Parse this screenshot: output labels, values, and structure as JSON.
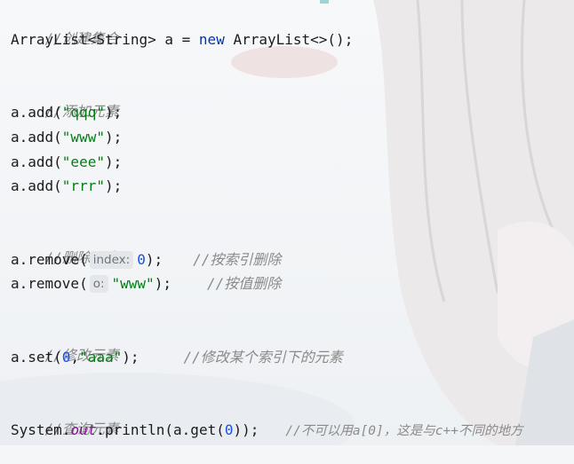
{
  "code": {
    "c_create": "//创建集合",
    "l_create": {
      "a": "ArrayList<String> a = ",
      "kw": "new",
      "b": " ArrayList<>();"
    },
    "c_add": "//添加元素",
    "add1": {
      "a": "a.add(",
      "s": "\"qqq\"",
      "b": ");"
    },
    "add2": {
      "a": "a.add(",
      "s": "\"www\"",
      "b": ");"
    },
    "add3": {
      "a": "a.add(",
      "s": "\"eee\"",
      "b": ");"
    },
    "add4": {
      "a": "a.add(",
      "s": "\"rrr\"",
      "b": ");"
    },
    "c_remove": "//删除元素",
    "rm1": {
      "a": "a.remove(",
      "hint": "index:",
      "n": "0",
      "b": ");",
      "c": "//按索引删除"
    },
    "rm2": {
      "a": "a.remove(",
      "hint": "o:",
      "s": "\"www\"",
      "b": ");",
      "c": "//按值删除"
    },
    "c_set": "//修改元素",
    "set1": {
      "a": "a.set(",
      "n": "0",
      "comma": ",",
      "s": "\"aaa\"",
      "b": ");",
      "c": "//修改某个索引下的元素"
    },
    "c_get": "//查询元素",
    "get1": {
      "a": "System.",
      "f": "out",
      "b": ".println(a.get(",
      "n": "0",
      "d": "));",
      "c": "//不可以用a[0]，这是与c++不同的地方"
    }
  },
  "colors": {
    "keyword": "#0033b3",
    "string": "#067d17",
    "number": "#1750eb",
    "comment": "#8a8a8a",
    "field": "#871094"
  }
}
